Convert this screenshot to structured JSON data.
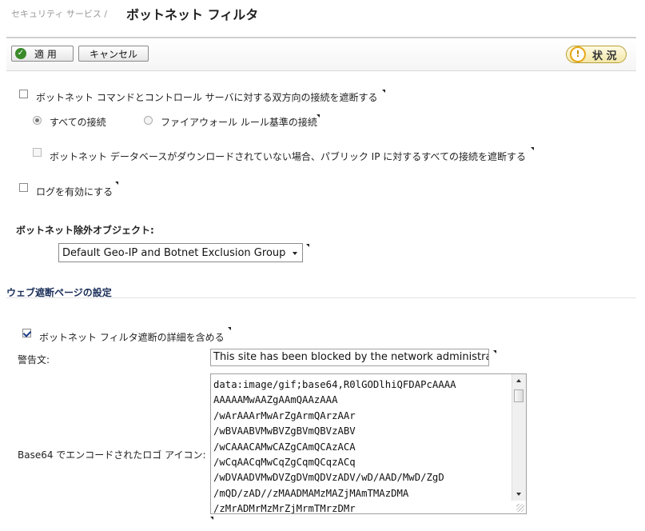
{
  "breadcrumb": {
    "parent": "セキュリティ サービス /",
    "title": "ボットネット フィルタ"
  },
  "toolbar": {
    "apply_label": "適 用",
    "cancel_label": "キャンセル",
    "status_label": "状 況"
  },
  "options": {
    "block_cc_label": "ボットネット コマンドとコントロール サーバに対する双方向の接続を遮断する",
    "block_cc_checked": false,
    "radio_all_label": "すべての接続",
    "radio_firewall_label": "ファイアウォール ルール基準の接続",
    "radio_selected": "all",
    "block_public_ip_label": "ボットネット データベースがダウンロードされていない場合、パブリック IP に対するすべての接続を遮断する",
    "block_public_ip_checked": false,
    "enable_log_label": "ログを有効にする",
    "enable_log_checked": false
  },
  "exclusion": {
    "label": "ボットネット除外オブジェクト:",
    "selected": "Default Geo-IP and Botnet Exclusion Group"
  },
  "web_block": {
    "section_title": "ウェブ遮断ページの設定",
    "include_details_label": "ボットネット フィルタ遮断の詳細を含める",
    "include_details_checked": true,
    "warning_label": "警告文:",
    "warning_value": "This site has been blocked by the network administrator.",
    "logo_label": "Base64 でエンコードされたロゴ アイコン:",
    "logo_lines": [
      "data:image/gif;base64,R0lGODlhiQFDAPcAAAA",
      "AAAAAMwAAZgAAmQAAzAAA",
      "/wArAAArMwArZgArmQArzAAr",
      "/wBVAABVMwBVZgBVmQBVzABV",
      "/wCAAACAMwCAZgCAmQCAzACA",
      "/wCqAACqMwCqZgCqmQCqzACq",
      "/wDVAADVMwDVZgDVmQDVzADV/wD/AAD/MwD/ZgD",
      "/mQD/zAD//zMAADMAMzMAZjMAmTMAzDMA",
      "/zMrADMrMzMrZjMrmTMrzDMr"
    ]
  },
  "colors": {
    "section": "#1b2f5a",
    "apply_icon": "#3a8a2a",
    "status_icon": "#e6a817"
  }
}
